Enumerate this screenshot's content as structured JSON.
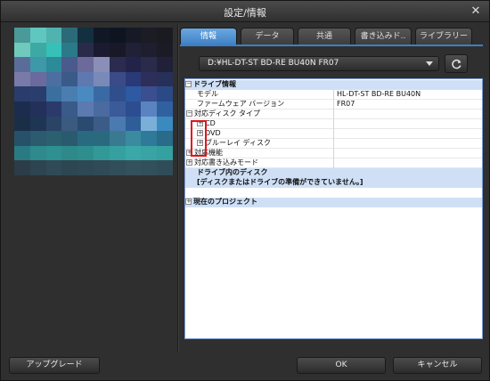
{
  "window": {
    "title": "設定/情報"
  },
  "tabs": [
    {
      "label": "情報",
      "active": true
    },
    {
      "label": "データ",
      "active": false
    },
    {
      "label": "共通",
      "active": false
    },
    {
      "label": "書き込みド..",
      "active": false
    },
    {
      "label": "ライブラリー",
      "active": false
    }
  ],
  "drive_select": {
    "value": "D:¥HL-DT-ST BD-RE BU40N FR07"
  },
  "properties": {
    "drive_info": "ドライブ情報",
    "model_label": "モデル",
    "model_value": "HL-DT-ST BD-RE BU40N",
    "firmware_label": "ファームウェア バージョン",
    "firmware_value": "FR07",
    "disc_types": "対応ディスク タイプ",
    "cd": "CD",
    "dvd": "DVD",
    "bluray": "ブルーレイ ディスク",
    "features": "対応機能",
    "write_modes": "対応書き込みモード",
    "disc_in_drive": "ドライブ内のディスク",
    "disc_status": "[ディスクまたはドライブの準備ができていません。]",
    "current_project": "現在のプロジェクト"
  },
  "buttons": {
    "upgrade": "アップグレード",
    "ok": "OK",
    "cancel": "キャンセル"
  },
  "colors": {
    "accent": "#3d7fc4",
    "highlight": "#e0141e",
    "category_bg": "#cfe0f6"
  }
}
